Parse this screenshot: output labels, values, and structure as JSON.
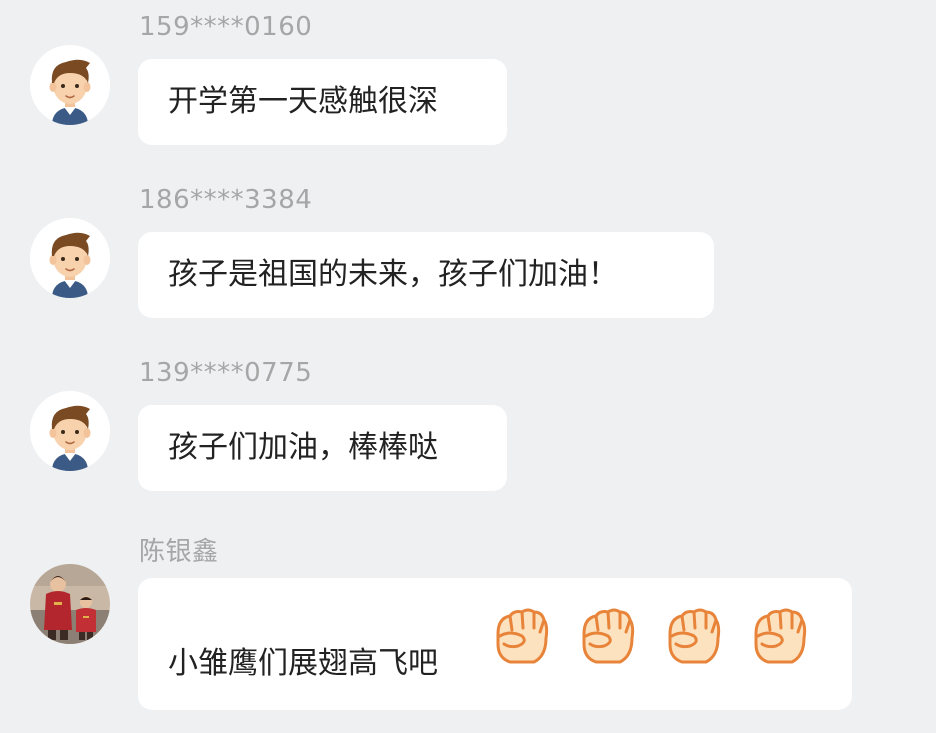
{
  "comments": [
    {
      "sender": "159****0160",
      "text": "开学第一天感触很深",
      "avatar": "cartoon-boy-avatar"
    },
    {
      "sender": "186****3384",
      "text": "孩子是祖国的未来，孩子们加油！",
      "avatar": "cartoon-boy-avatar"
    },
    {
      "sender": "139****0775",
      "text": "孩子们加油，棒棒哒",
      "avatar": "cartoon-boy-avatar"
    },
    {
      "sender": "陈银鑫",
      "text": "小雏鹰们展翅高飞吧",
      "avatar": "children-photo-avatar",
      "emoji": [
        "fist-emoji",
        "fist-emoji",
        "fist-emoji",
        "fist-emoji"
      ]
    }
  ],
  "colors": {
    "background": "#eff0f2",
    "bubble": "#ffffff",
    "sender_text": "#a6a6a6",
    "message_text": "#222222",
    "fist_fill": "#fde2c0",
    "fist_stroke": "#e8843a"
  }
}
